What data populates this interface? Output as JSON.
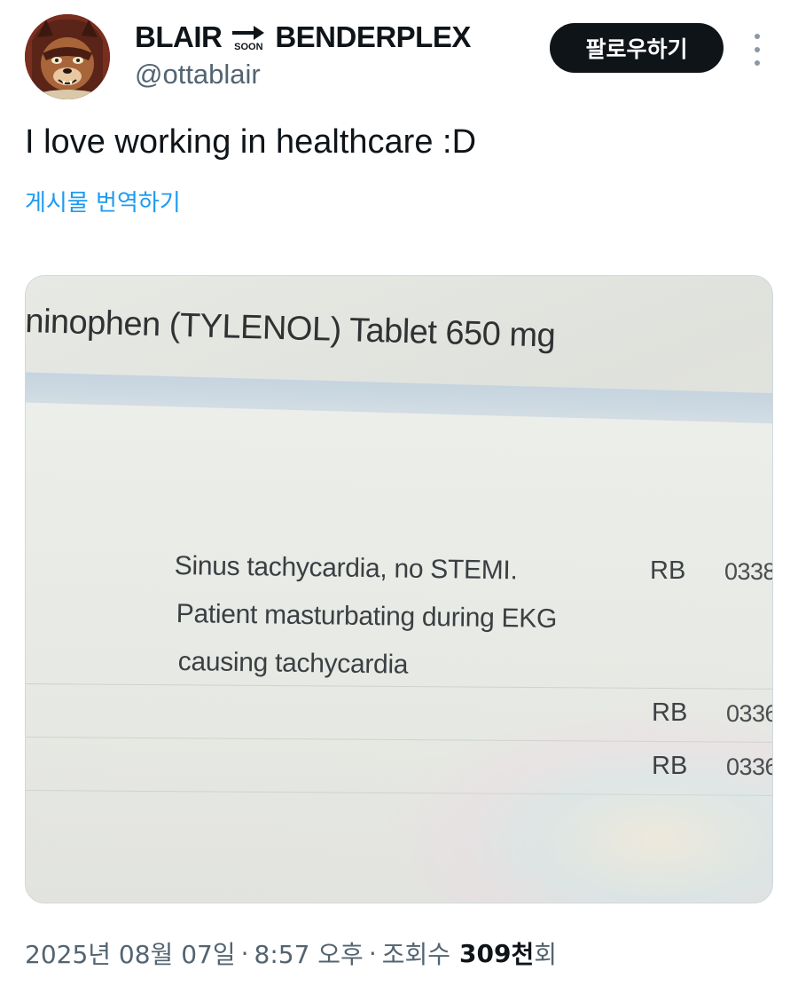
{
  "author": {
    "name_before": "BLAIR",
    "name_arrow_caption": "SOON",
    "name_after": "BENDERPLEX",
    "handle": "@ottablair"
  },
  "actions": {
    "follow_label": "팔로우하기",
    "more_icon": "more-vertical-icon"
  },
  "post": {
    "text": "I love working in healthcare :D",
    "translate_label": "게시물 번역하기"
  },
  "media": {
    "medication_header": "ninophen (TYLENOL) Tablet 650 mg",
    "note_lines": [
      "Sinus tachycardia, no STEMI.",
      "Patient masturbating during EKG",
      "causing tachycardia"
    ],
    "rows": [
      {
        "initials": "RB",
        "code": "0338"
      },
      {
        "initials": "RB",
        "code": "0336"
      },
      {
        "initials": "RB",
        "code": "0336"
      }
    ]
  },
  "meta": {
    "date": "2025년 08월 07일",
    "separator": "·",
    "time": "8:57 오후",
    "views_label": "조회수",
    "views_number": "309",
    "views_unit": "천",
    "views_suffix": "회"
  },
  "colors": {
    "accent": "#1d9bf0",
    "button_bg": "#0f1419",
    "secondary_text": "#536471"
  }
}
